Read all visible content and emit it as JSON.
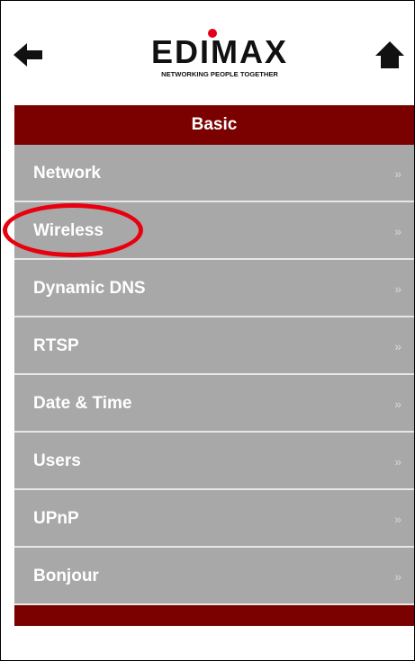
{
  "header": {
    "logo_text": "EDIMAX",
    "logo_tagline": "NETWORKING PEOPLE TOGETHER"
  },
  "section": {
    "title": "Basic"
  },
  "menu": {
    "items": [
      {
        "label": "Network",
        "chevron": "»"
      },
      {
        "label": "Wireless",
        "chevron": "»"
      },
      {
        "label": "Dynamic DNS",
        "chevron": "»"
      },
      {
        "label": "RTSP",
        "chevron": "»"
      },
      {
        "label": "Date & Time",
        "chevron": "»"
      },
      {
        "label": "Users",
        "chevron": "»"
      },
      {
        "label": "UPnP",
        "chevron": "»"
      },
      {
        "label": "Bonjour",
        "chevron": "»"
      }
    ]
  },
  "icons": {
    "back": "arrow-left-icon",
    "home": "home-icon"
  },
  "colors": {
    "section_bar": "#7b0000",
    "menu_item": "#a8a8a8",
    "highlight": "#e8000f",
    "logo_dot": "#e3001b"
  }
}
